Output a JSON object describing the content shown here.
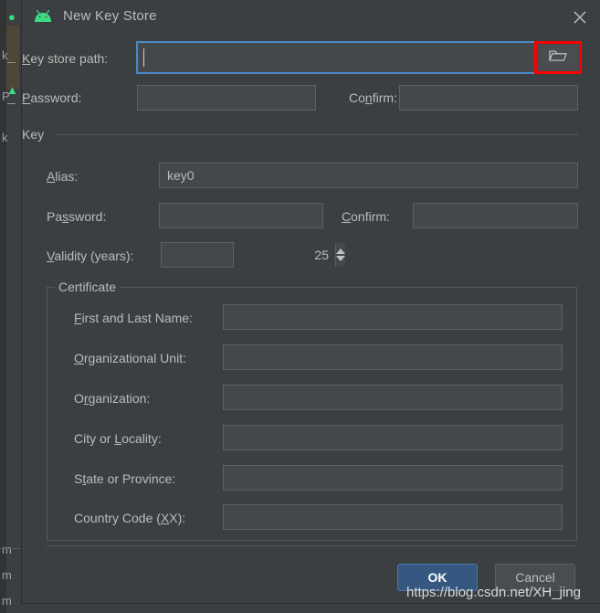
{
  "window": {
    "title": "New Key Store",
    "app_icon": "android-robot-icon",
    "close_icon": "close-icon"
  },
  "colors": {
    "dialog_background": "#3c3f41",
    "field_background": "#45484a",
    "field_border": "#5e6060",
    "text": "#bbbbbb",
    "focus_border": "#4a88c7",
    "highlight_annotation": "#ff0000",
    "primary_button": "#365880",
    "android_green": "#3ddc84"
  },
  "keystore": {
    "path_label": "Key store path:",
    "path_label_mnemonic": "K",
    "path_value": "",
    "path_placeholder": "",
    "browse_icon": "folder-icon",
    "password_label": "Password:",
    "password_label_mnemonic": "P",
    "password_value": "",
    "confirm_label": "Confirm:",
    "confirm_label_mnemonic": "n",
    "confirm_value": ""
  },
  "key_group": {
    "title": "Key",
    "alias_label": "Alias:",
    "alias_label_mnemonic": "A",
    "alias_value": "key0",
    "password_label": "Password:",
    "password_label_mnemonic": "s",
    "password_value": "",
    "confirm_label": "Confirm:",
    "confirm_label_mnemonic": "C",
    "confirm_value": "",
    "validity_label": "Validity (years):",
    "validity_label_mnemonic": "V",
    "validity_value": "25",
    "spinner_up_icon": "chevron-up-icon",
    "spinner_down_icon": "chevron-down-icon"
  },
  "certificate": {
    "legend": "Certificate",
    "fields": [
      {
        "label": "First and Last Name:",
        "mnemonic": "F",
        "value": ""
      },
      {
        "label": "Organizational Unit:",
        "mnemonic": "O",
        "value": ""
      },
      {
        "label": "Organization:",
        "mnemonic": "r",
        "value": ""
      },
      {
        "label": "City or Locality:",
        "mnemonic": "L",
        "value": ""
      },
      {
        "label": "State or Province:",
        "mnemonic": "t",
        "value": ""
      },
      {
        "label": "Country Code (XX):",
        "mnemonic": "X",
        "value": ""
      }
    ]
  },
  "footer": {
    "ok_label": "OK",
    "cancel_label": "Cancel"
  },
  "overlay": {
    "watermark": "https://blog.csdn.net/XH_jing"
  },
  "backdrop": {
    "fragments": [
      "k",
      "P",
      "k",
      "m",
      "m",
      "m"
    ]
  }
}
